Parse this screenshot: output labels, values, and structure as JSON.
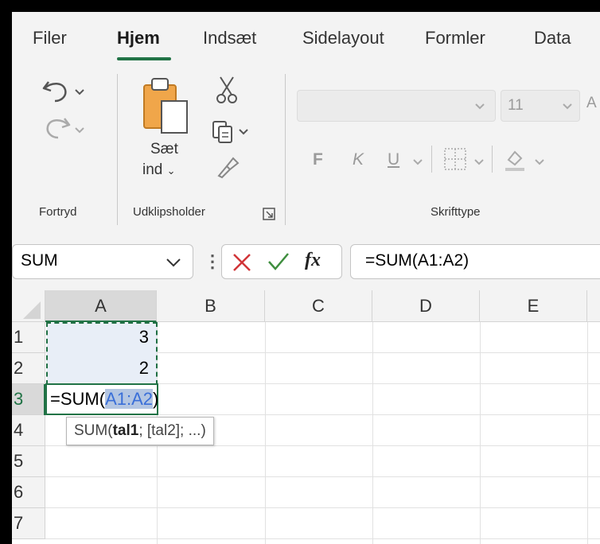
{
  "menu": {
    "tabs": [
      {
        "label": "Filer"
      },
      {
        "label": "Hjem"
      },
      {
        "label": "Indsæt"
      },
      {
        "label": "Sidelayout"
      },
      {
        "label": "Formler"
      },
      {
        "label": "Data"
      }
    ],
    "active_tab": "Hjem"
  },
  "ribbon": {
    "undo_group_label": "Fortryd",
    "paste_label_line1": "Sæt",
    "paste_label_line2": "ind",
    "clipboard_group_label": "Udklipsholder",
    "font_group_label": "Skrifttype",
    "font_size": "11",
    "bold_label": "F",
    "italic_label": "K",
    "underline_label": "U"
  },
  "formula_bar": {
    "name_box": "SUM",
    "fx_label": "fx",
    "formula": "=SUM(A1:A2)"
  },
  "grid": {
    "columns": [
      "A",
      "B",
      "C",
      "D",
      "E"
    ],
    "rows": [
      "1",
      "2",
      "3",
      "4",
      "5",
      "6",
      "7"
    ],
    "cells": {
      "A1": "3",
      "A2": "2",
      "A3_prefix": "=SUM(",
      "A3_ref": "A1:A2",
      "A3_suffix": ")"
    }
  },
  "tooltip": {
    "fn": "SUM(",
    "arg1": "tal1",
    "rest": "; [tal2]; ...)"
  },
  "colors": {
    "accent_green": "#217346",
    "selection_fill": "#e8eef7",
    "ref_highlight": "#b4c6e2",
    "ref_text": "#3a6fd8",
    "cancel_red": "#d13438",
    "enter_green": "#3e8e3e"
  }
}
